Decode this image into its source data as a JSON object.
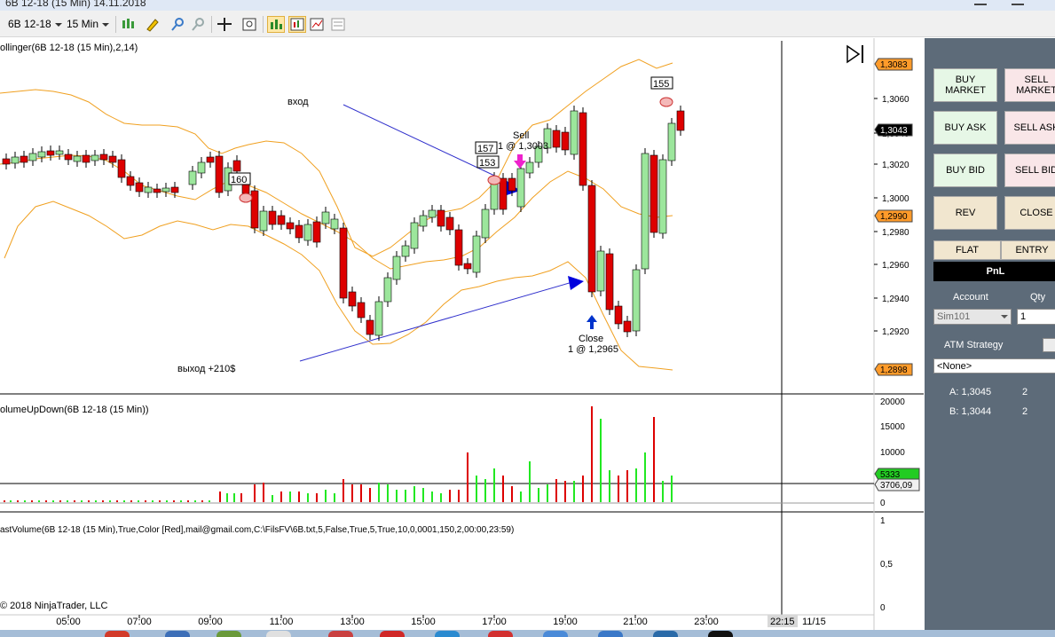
{
  "window": {
    "title": "6B 12-18 (15 Min)  14.11.2018"
  },
  "toolbar": {
    "instrument": "6B 12-18",
    "interval": "15 Min",
    "icons": [
      "bar-type-icon",
      "draw-pen-icon",
      "zoom-in-icon",
      "zoom-out-icon",
      "crosshair-icon",
      "properties-icon",
      "indicators-icon",
      "strategies-icon",
      "chart-trader-icon",
      "data-box-icon",
      "snapshot-icon"
    ]
  },
  "chart": {
    "bollinger_label": "ollinger(6B 12-18 (15 Min),2,14)",
    "volume_label": "olumeUpDown(6B 12-18 (15 Min))",
    "fastvolume_label": "astVolume(6B 12-18 (15 Min),True,Color [Red],mail@gmail.com,C:\\FilsFV\\6B.txt,5,False,True,5,True,10,0,0001,150,2,00:00,23:59)",
    "copyright": "© 2018 NinjaTrader, LLC",
    "price_axis": [
      "1,3060",
      "1,3040",
      "1,3020",
      "1,3000",
      "1,2980",
      "1,2960",
      "1,2940",
      "1,2920"
    ],
    "price_markers": [
      {
        "text": "1,3083",
        "color": "#ff9b2a"
      },
      {
        "text": "1,3043",
        "color": "#000000"
      },
      {
        "text": "1,2990",
        "color": "#ff9b2a"
      },
      {
        "text": "1,2898",
        "color": "#ff9b2a"
      }
    ],
    "volume_axis": [
      "20000",
      "15000",
      "10000",
      "5000",
      "0"
    ],
    "volume_markers": [
      {
        "text": "5333",
        "color": "#22cc22"
      },
      {
        "text": "3706,09",
        "color": "#f0f0f0"
      }
    ],
    "fast_axis": [
      "1",
      "0,5",
      "0"
    ],
    "time_axis": [
      "05:00",
      "07:00",
      "09:00",
      "11:00",
      "13:00",
      "15:00",
      "17:00",
      "19:00",
      "21:00",
      "23:00"
    ],
    "cursor_time": "22:15",
    "cursor_date": "11/15",
    "annotations": {
      "entry": "вход",
      "exit": "выход   +210$",
      "sell_line1": "Sell",
      "sell_line2": "1 @ 1,3003",
      "close_line1": "Close",
      "close_line2": "1 @ 1,2965"
    },
    "bar_tags": [
      "160",
      "157",
      "153",
      "155"
    ],
    "colors": {
      "bull": "#9ce69c",
      "bear": "#dd0000",
      "band": "#f0a020",
      "trend": "#3030cc"
    }
  },
  "panel": {
    "buy_market": "BUY MARKET",
    "sell_market": "SELL MARKET",
    "buy_ask": "BUY ASK",
    "sell_ask": "SELL ASK",
    "buy_bid": "BUY BID",
    "sell_bid": "SELL BID",
    "rev": "REV",
    "close": "CLOSE",
    "flat": "FLAT",
    "entry": "ENTRY",
    "pnl": "PnL",
    "account_label": "Account",
    "qty_label": "Qty",
    "account_value": "Sim101",
    "qty_value": "1",
    "atm_label": "ATM Strategy",
    "atm_value": "<None>",
    "ask_label": "A: 1,3045",
    "ask_qty": "2",
    "bid_label": "B: 1,3044",
    "bid_qty": "2"
  }
}
